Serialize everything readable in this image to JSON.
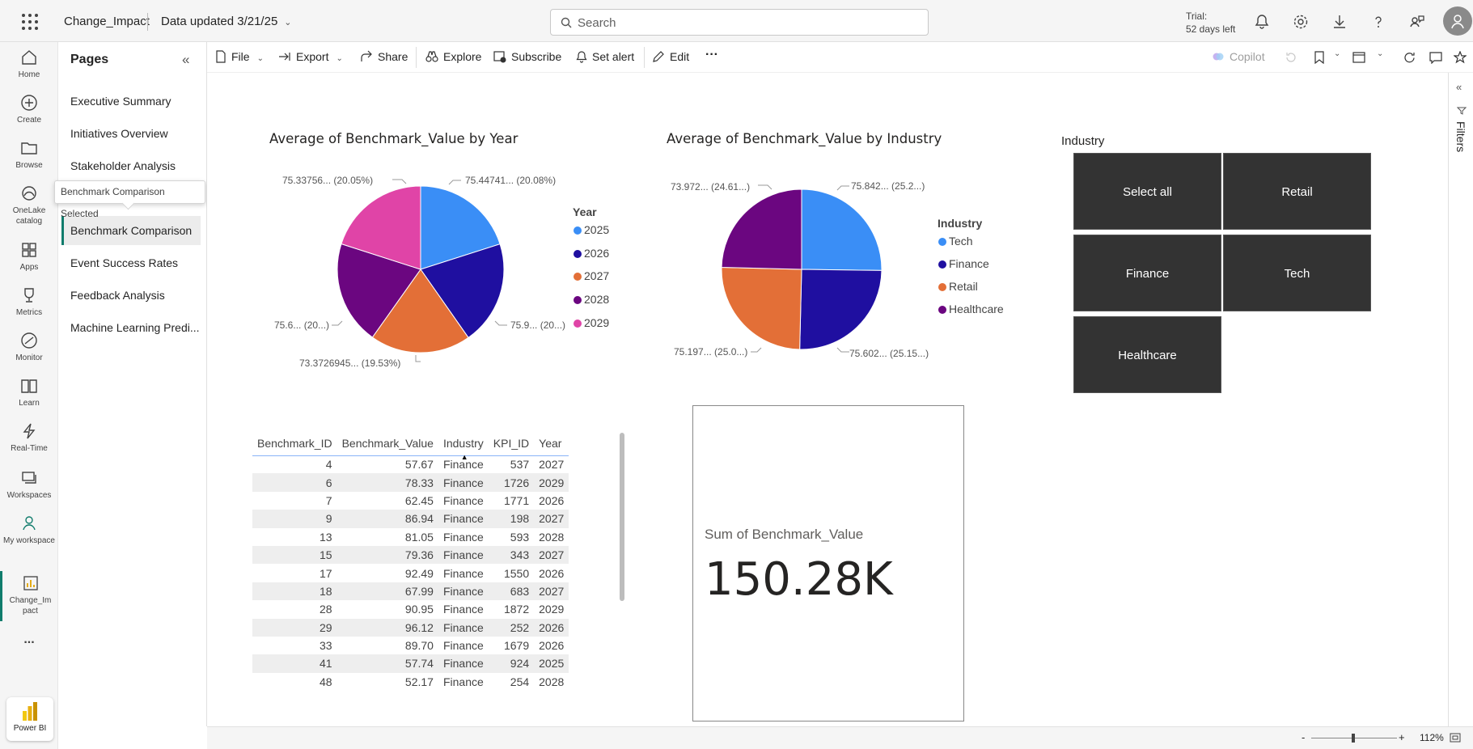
{
  "topbar": {
    "app_name": "Change_Impact",
    "data_updated": "Data updated 3/21/25",
    "search_placeholder": "Search",
    "trial_line1": "Trial:",
    "trial_line2": "52 days left"
  },
  "leftnav": {
    "items": [
      {
        "label": "Home",
        "icon": "home-icon"
      },
      {
        "label": "Create",
        "icon": "create-icon"
      },
      {
        "label": "Browse",
        "icon": "folder-icon"
      },
      {
        "label": "OneLake catalog",
        "icon": "onelake-icon"
      },
      {
        "label": "Apps",
        "icon": "apps-icon"
      },
      {
        "label": "Metrics",
        "icon": "trophy-icon"
      },
      {
        "label": "Monitor",
        "icon": "monitor-icon"
      },
      {
        "label": "Learn",
        "icon": "book-icon"
      },
      {
        "label": "Real-Time",
        "icon": "lightning-icon"
      },
      {
        "label": "Workspaces",
        "icon": "workspaces-icon"
      },
      {
        "label": "My workspace",
        "icon": "person-icon"
      },
      {
        "label": "Change_Im pact",
        "icon": "report-icon"
      }
    ],
    "more": "...",
    "powerbi_label": "Power BI"
  },
  "pages_pane": {
    "title": "Pages",
    "items": [
      "Executive Summary",
      "Initiatives Overview",
      "Stakeholder Analysis",
      "Benchmark Comparison",
      "Event Success Rates",
      "Feedback Analysis",
      "Machine Learning Predi..."
    ],
    "selected_index": 3,
    "tooltip": "Benchmark Comparison Selected"
  },
  "toolbar": {
    "file": "File",
    "export": "Export",
    "share": "Share",
    "explore": "Explore",
    "subscribe": "Subscribe",
    "set_alert": "Set alert",
    "edit": "Edit",
    "copilot": "Copilot"
  },
  "filters_label": "Filters",
  "colors": {
    "blue": "#3a8ef6",
    "navy": "#1f0fa0",
    "orange": "#e36f37",
    "purple": "#6b0680",
    "pink": "#e044a7",
    "slicer_bg": "#333333",
    "accent": "#107c6c"
  },
  "chart_data": [
    {
      "type": "pie",
      "title": "Average of Benchmark_Value by Year",
      "legend_title": "Year",
      "legend_position": "right",
      "categories": [
        "2025",
        "2026",
        "2027",
        "2028",
        "2029"
      ],
      "values": [
        75.44741,
        75.9,
        73.3726945,
        75.6,
        75.33756
      ],
      "percent": [
        20.08,
        20.0,
        19.53,
        20.0,
        20.05
      ],
      "labels": [
        "75.44741... (20.08%)",
        "75.9... (20...)",
        "73.3726945... (19.53%)",
        "75.6... (20...)",
        "75.33756... (20.05%)"
      ],
      "colors": [
        "#3a8ef6",
        "#1f0fa0",
        "#e36f37",
        "#6b0680",
        "#e044a7"
      ]
    },
    {
      "type": "pie",
      "title": "Average of Benchmark_Value by Industry",
      "legend_title": "Industry",
      "legend_position": "right",
      "categories": [
        "Tech",
        "Finance",
        "Retail",
        "Healthcare"
      ],
      "values": [
        75.842,
        75.602,
        75.197,
        73.972
      ],
      "percent": [
        25.2,
        25.15,
        25.0,
        24.61
      ],
      "labels": [
        "75.842... (25.2...)",
        "75.602... (25.15...)",
        "75.197... (25.0...)",
        "73.972... (24.61...)"
      ],
      "colors": [
        "#3a8ef6",
        "#1f0fa0",
        "#e36f37",
        "#6b0680"
      ]
    }
  ],
  "slicer": {
    "title": "Industry",
    "buttons": [
      "Select all",
      "Retail",
      "Finance",
      "Tech",
      "Healthcare"
    ]
  },
  "table": {
    "columns": [
      "Benchmark_ID",
      "Benchmark_Value",
      "Industry",
      "KPI_ID",
      "Year"
    ],
    "rows": [
      [
        "4",
        "57.67",
        "Finance",
        "537",
        "2027"
      ],
      [
        "6",
        "78.33",
        "Finance",
        "1726",
        "2029"
      ],
      [
        "7",
        "62.45",
        "Finance",
        "1771",
        "2026"
      ],
      [
        "9",
        "86.94",
        "Finance",
        "198",
        "2027"
      ],
      [
        "13",
        "81.05",
        "Finance",
        "593",
        "2028"
      ],
      [
        "15",
        "79.36",
        "Finance",
        "343",
        "2027"
      ],
      [
        "17",
        "92.49",
        "Finance",
        "1550",
        "2026"
      ],
      [
        "18",
        "67.99",
        "Finance",
        "683",
        "2027"
      ],
      [
        "28",
        "90.95",
        "Finance",
        "1872",
        "2029"
      ],
      [
        "29",
        "96.12",
        "Finance",
        "252",
        "2026"
      ],
      [
        "33",
        "89.70",
        "Finance",
        "1679",
        "2026"
      ],
      [
        "41",
        "57.74",
        "Finance",
        "924",
        "2025"
      ],
      [
        "48",
        "52.17",
        "Finance",
        "254",
        "2028"
      ]
    ]
  },
  "card": {
    "label": "Sum of Benchmark_Value",
    "value": "150.28K"
  },
  "statusbar": {
    "zoom": "112%",
    "minus": "-",
    "plus": "+"
  }
}
